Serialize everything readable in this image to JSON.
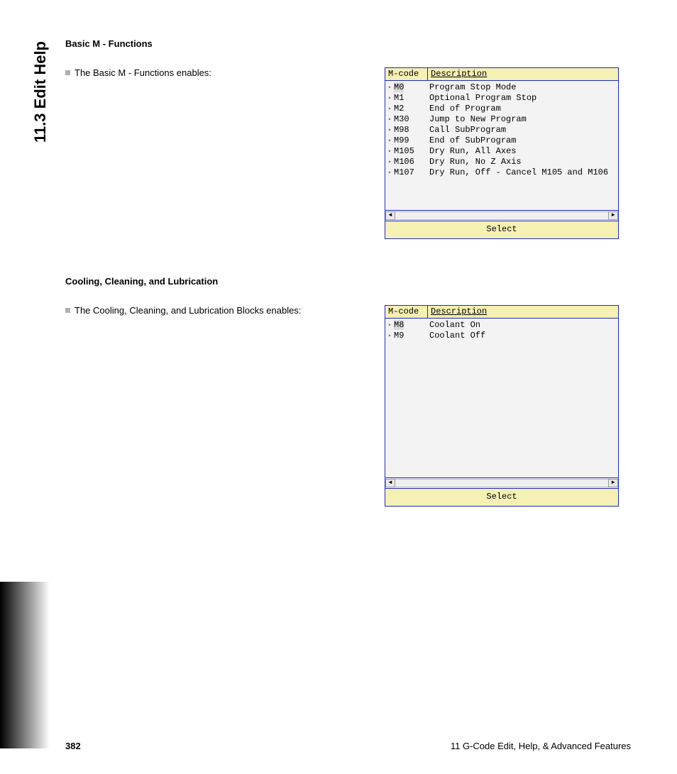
{
  "side_tab": "11.3 Edit Help",
  "section1": {
    "heading": "Basic M - Functions",
    "line": "The Basic M - Functions enables:"
  },
  "section2": {
    "heading": "Cooling, Cleaning, and Lubrication",
    "line": "The Cooling, Cleaning, and Lubrication Blocks enables:"
  },
  "dialog": {
    "header_code": "M-code",
    "header_desc": "Description",
    "footer": "Select",
    "arrow_left": "◄",
    "arrow_right": "►"
  },
  "table1": {
    "rows": [
      {
        "code": "M0",
        "desc": "Program Stop Mode"
      },
      {
        "code": "M1",
        "desc": "Optional Program Stop"
      },
      {
        "code": "M2",
        "desc": "End of Program"
      },
      {
        "code": "M30",
        "desc": "Jump to New Program"
      },
      {
        "code": "M98",
        "desc": "Call SubProgram"
      },
      {
        "code": "M99",
        "desc": "End of SubProgram"
      },
      {
        "code": "M105",
        "desc": "Dry Run, All Axes"
      },
      {
        "code": "M106",
        "desc": "Dry Run, No Z Axis"
      },
      {
        "code": "M107",
        "desc": "Dry Run, Off - Cancel M105 and M106"
      }
    ]
  },
  "table2": {
    "rows": [
      {
        "code": "M8",
        "desc": "Coolant On"
      },
      {
        "code": "M9",
        "desc": "Coolant Off"
      }
    ]
  },
  "footer": {
    "page": "382",
    "chapter": "11 G-Code Edit, Help, & Advanced Features"
  }
}
